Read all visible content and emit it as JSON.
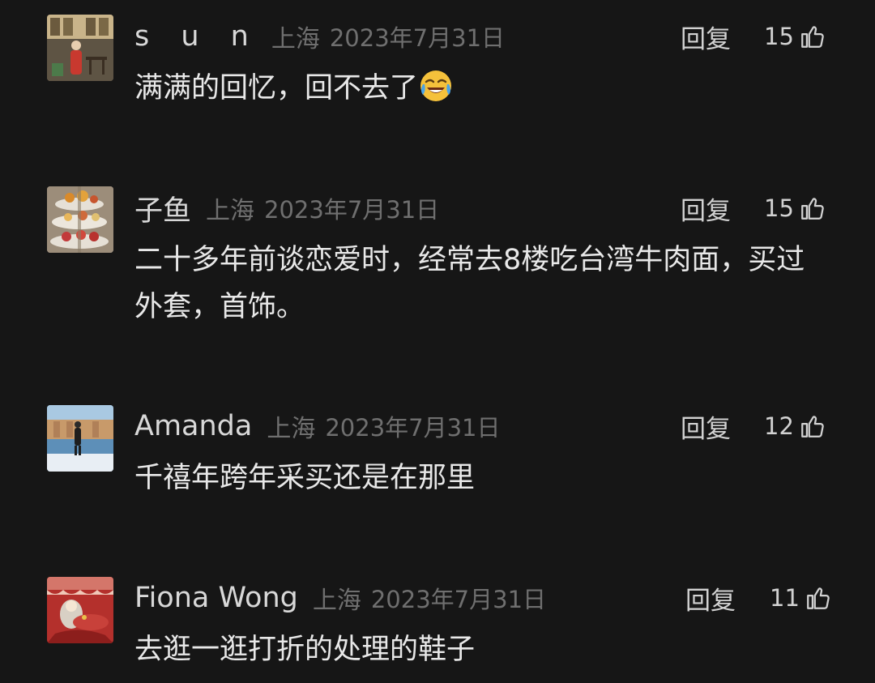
{
  "comments": [
    {
      "name": "s u n",
      "location": "上海",
      "date": "2023年7月31日",
      "reply_label": "回复",
      "likes": "15",
      "text": "满满的回忆，回不去了",
      "emoji": "crying-laughing-emoji"
    },
    {
      "name": "子鱼",
      "location": "上海",
      "date": "2023年7月31日",
      "reply_label": "回复",
      "likes": "15",
      "text": "二十多年前谈恋爱时，经常去8楼吃台湾牛肉面，买过外套，首饰。"
    },
    {
      "name": "Amanda",
      "location": "上海",
      "date": "2023年7月31日",
      "reply_label": "回复",
      "likes": "12",
      "text": "千禧年跨年采买还是在那里"
    },
    {
      "name": "Fiona Wong",
      "location": "上海",
      "date": "2023年7月31日",
      "reply_label": "回复",
      "likes": "11",
      "text": "去逛一逛打折的处理的鞋子"
    }
  ],
  "icons": {
    "like": "thumbs-up-icon"
  },
  "colors": {
    "background": "#161616",
    "text": "#e8e8e8",
    "meta": "#6f6f6f"
  }
}
